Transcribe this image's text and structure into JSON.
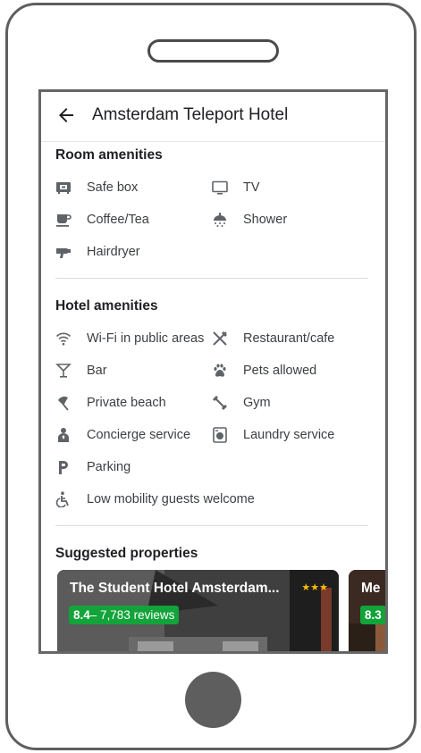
{
  "app_bar": {
    "title": "Amsterdam Teleport Hotel"
  },
  "room_amenities": {
    "title": "Room amenities",
    "items": [
      {
        "label": "Safe box",
        "icon": "safe-box-icon"
      },
      {
        "label": "TV",
        "icon": "tv-icon"
      },
      {
        "label": "Coffee/Tea",
        "icon": "coffee-icon"
      },
      {
        "label": "Shower",
        "icon": "shower-icon"
      },
      {
        "label": "Hairdryer",
        "icon": "hairdryer-icon"
      }
    ]
  },
  "hotel_amenities": {
    "title": "Hotel amenities",
    "items": [
      {
        "label": "Wi-Fi in public areas",
        "icon": "wifi-icon"
      },
      {
        "label": "Restaurant/cafe",
        "icon": "restaurant-icon"
      },
      {
        "label": "Bar",
        "icon": "bar-icon"
      },
      {
        "label": "Pets allowed",
        "icon": "paw-icon"
      },
      {
        "label": "Private beach",
        "icon": "beach-umbrella-icon"
      },
      {
        "label": "Gym",
        "icon": "dumbbell-icon"
      },
      {
        "label": "Concierge service",
        "icon": "concierge-icon"
      },
      {
        "label": "Laundry service",
        "icon": "laundry-icon"
      },
      {
        "label": "Parking",
        "icon": "parking-icon"
      },
      {
        "label": "Low mobility guests welcome",
        "icon": "accessibility-icon"
      }
    ]
  },
  "suggested": {
    "title": "Suggested properties",
    "cards": [
      {
        "name": "The Student Hotel Amsterdam...",
        "stars": "★★★",
        "score": "8.4",
        "reviews": " – 7,783 reviews"
      },
      {
        "name": "Me",
        "score": "8.3"
      }
    ]
  },
  "colors": {
    "rating_badge": "#12a33a",
    "star": "#fbbc04",
    "icon": "#5f6368"
  }
}
